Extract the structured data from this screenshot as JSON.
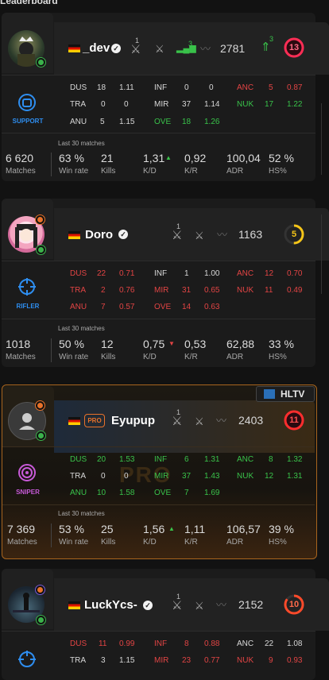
{
  "top_text": "Leaderboard",
  "colors": {
    "accent_green": "#39c24a",
    "accent_red": "#e24444",
    "orange": "#e8722a",
    "bg": "#121212"
  },
  "players": [
    {
      "name": "_dev",
      "country_flag": "flag-germany",
      "verified": true,
      "role": "SUPPORT",
      "role_icon": "raised-fist-icon",
      "sword_count": "1",
      "signal_count": "3",
      "elo": "2781",
      "elo_trend_count": "3",
      "level": "13",
      "level_fraction": 1.0,
      "maps": {
        "left": [
          [
            "DUS",
            "18",
            "1.11"
          ],
          [
            "TRA",
            "0",
            "0"
          ],
          [
            "ANU",
            "5",
            "1.15"
          ]
        ],
        "middle": [
          [
            "INF",
            "0",
            "0"
          ],
          [
            "MIR",
            "37",
            "1.14"
          ],
          [
            "OVE",
            "18",
            "1.26"
          ]
        ],
        "right": [
          [
            "ANC",
            "5",
            "0.87"
          ],
          [
            "NUK",
            "17",
            "1.22"
          ]
        ]
      },
      "stats": {
        "last30_label": "Last 30 matches",
        "matches": "6 620",
        "matches_label": "Matches",
        "winrate": "63 %",
        "winrate_label": "Win rate",
        "kills": "21",
        "kills_label": "Kills",
        "kd": "1,31",
        "kd_label": "K/D",
        "kr": "0,92",
        "kr_label": "K/R",
        "adr": "100,04",
        "adr_label": "ADR",
        "hs": "52 %",
        "hs_label": "HS%"
      }
    },
    {
      "name": "Doro",
      "country_flag": "flag-germany",
      "verified": true,
      "role": "RIFLER",
      "role_icon": "crosshair-icon",
      "sword_count": "1",
      "elo": "1163",
      "level": "5",
      "level_fraction": 0.5,
      "maps": {
        "left": [
          [
            "DUS",
            "22",
            "0.71"
          ],
          [
            "TRA",
            "2",
            "0.76"
          ],
          [
            "ANU",
            "7",
            "0.57"
          ]
        ],
        "middle": [
          [
            "INF",
            "1",
            "1.00"
          ],
          [
            "MIR",
            "31",
            "0.65"
          ],
          [
            "OVE",
            "14",
            "0.63"
          ]
        ],
        "right": [
          [
            "ANC",
            "12",
            "0.70"
          ],
          [
            "NUK",
            "11",
            "0.49"
          ]
        ]
      },
      "stats": {
        "last30_label": "Last 30 matches",
        "matches": "1018",
        "matches_label": "Matches",
        "winrate": "50 %",
        "winrate_label": "Win rate",
        "kills": "12",
        "kills_label": "Kills",
        "kd": "0,75",
        "kd_label": "K/D",
        "kr": "0,53",
        "kr_label": "K/R",
        "adr": "62,88",
        "adr_label": "ADR",
        "hs": "33 %",
        "hs_label": "HS%"
      }
    },
    {
      "name": "Eyupup",
      "country_flag": "flag-germany",
      "pro_badge": "PRO",
      "hltv_label": "HLTV",
      "watermark": "PRO",
      "role": "SNIPER",
      "role_icon": "target-icon",
      "sword_count": "1",
      "elo": "2403",
      "level": "11",
      "level_fraction": 1.0,
      "maps": {
        "left": [
          [
            "DUS",
            "20",
            "1.53"
          ],
          [
            "TRA",
            "0",
            "0"
          ],
          [
            "ANU",
            "10",
            "1.58"
          ]
        ],
        "middle": [
          [
            "INF",
            "6",
            "1.31"
          ],
          [
            "MIR",
            "37",
            "1.43"
          ],
          [
            "OVE",
            "7",
            "1.69"
          ]
        ],
        "right": [
          [
            "ANC",
            "8",
            "1.32"
          ],
          [
            "NUK",
            "12",
            "1.31"
          ]
        ]
      },
      "stats": {
        "last30_label": "Last 30 matches",
        "matches": "7 369",
        "matches_label": "Matches",
        "winrate": "53 %",
        "winrate_label": "Win rate",
        "kills": "25",
        "kills_label": "Kills",
        "kd": "1,56",
        "kd_label": "K/D",
        "kr": "1,11",
        "kr_label": "K/R",
        "adr": "106,57",
        "adr_label": "ADR",
        "hs": "39 %",
        "hs_label": "HS%"
      }
    },
    {
      "name": "LuckYcs-",
      "country_flag": "flag-germany",
      "verified": true,
      "sword_count": "1",
      "elo": "2152",
      "level": "10",
      "level_fraction": 0.85,
      "maps": {
        "left": [
          [
            "DUS",
            "11",
            "0.99"
          ],
          [
            "TRA",
            "3",
            "1.15"
          ]
        ],
        "middle": [
          [
            "INF",
            "8",
            "0.88"
          ],
          [
            "MIR",
            "23",
            "0.77"
          ]
        ],
        "right": [
          [
            "ANC",
            "22",
            "1.08"
          ],
          [
            "NUK",
            "9",
            "0.93"
          ]
        ]
      }
    }
  ]
}
